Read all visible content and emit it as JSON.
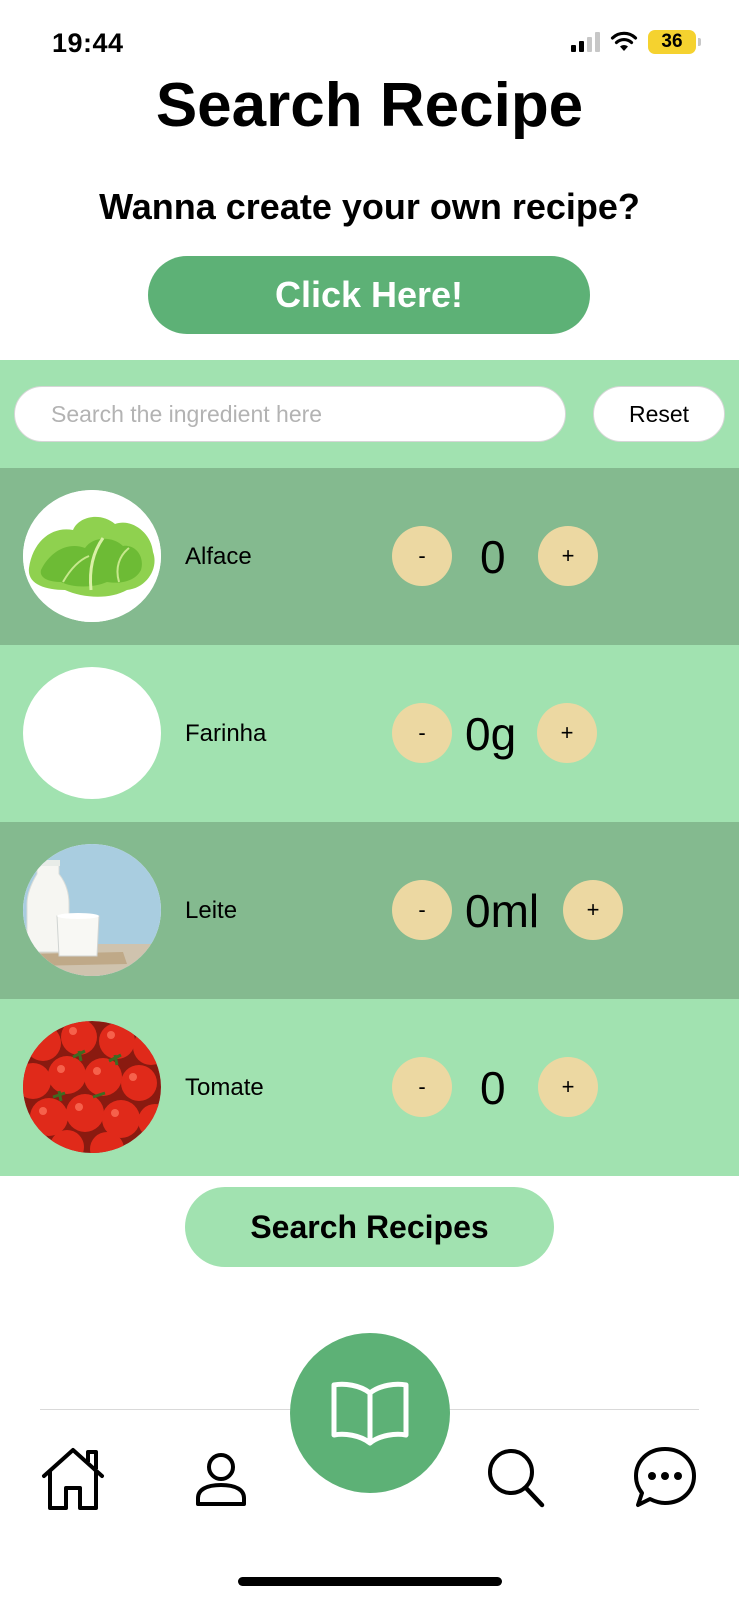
{
  "status_bar": {
    "time": "19:44",
    "battery": "36"
  },
  "header": {
    "title": "Search Recipe",
    "subtitle": "Wanna create your own recipe?",
    "cta_label": "Click Here!"
  },
  "search": {
    "placeholder": "Search the ingredient here",
    "reset_label": "Reset"
  },
  "ingredients": [
    {
      "name": "Alface",
      "quantity": "0",
      "minus": "-",
      "plus": "+",
      "image_icon": "lettuce-image"
    },
    {
      "name": "Farinha",
      "quantity": "0g",
      "minus": "-",
      "plus": "+",
      "image_icon": "flour-image-blank"
    },
    {
      "name": "Leite",
      "quantity": "0ml",
      "minus": "-",
      "plus": "+",
      "image_icon": "milk-image"
    },
    {
      "name": "Tomate",
      "quantity": "0",
      "minus": "-",
      "plus": "+",
      "image_icon": "tomato-image"
    }
  ],
  "search_recipes_label": "Search Recipes",
  "bottom_nav": {
    "items": [
      "home-icon",
      "profile-icon",
      "book-icon",
      "search-icon",
      "chat-icon"
    ]
  },
  "colors": {
    "accent": "#5db176",
    "row_dark": "#84ba8f",
    "row_light": "#a1e2b0",
    "qty_button": "#ecd8a2",
    "battery": "#f5d22f"
  }
}
